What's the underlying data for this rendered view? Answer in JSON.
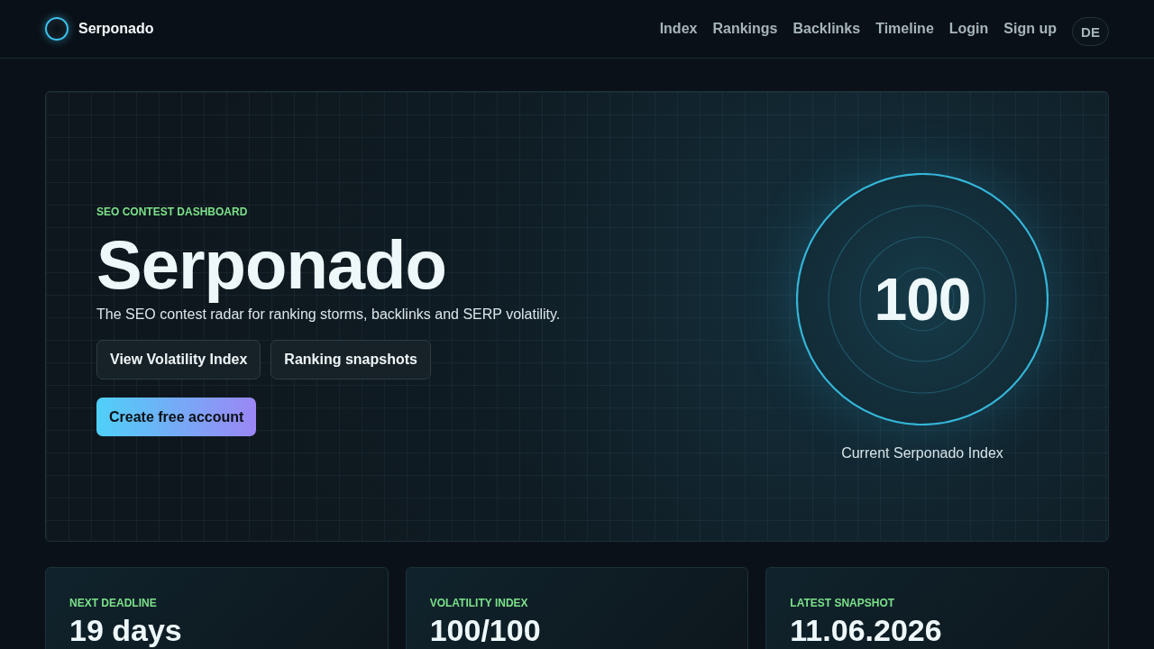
{
  "brand": {
    "name": "Serponado"
  },
  "nav": {
    "links": [
      "Index",
      "Rankings",
      "Backlinks",
      "Timeline",
      "Login",
      "Sign up"
    ],
    "language": "DE"
  },
  "hero": {
    "eyebrow": "SEO CONTEST DASHBOARD",
    "title": "Serponado",
    "subtitle": "The SEO contest radar for ranking storms, backlinks and SERP volatility.",
    "buttons": [
      {
        "label": "View Volatility Index",
        "kind": "secondary"
      },
      {
        "label": "Ranking snapshots",
        "kind": "secondary"
      },
      {
        "label": "Create free account",
        "kind": "primary"
      }
    ],
    "radar": {
      "value": "100",
      "caption": "Current Serponado Index"
    }
  },
  "stats": [
    {
      "label": "NEXT DEADLINE",
      "value": "19 days"
    },
    {
      "label": "VOLATILITY INDEX",
      "value": "100/100"
    },
    {
      "label": "LATEST SNAPSHOT",
      "value": "11.06.2026"
    }
  ]
}
